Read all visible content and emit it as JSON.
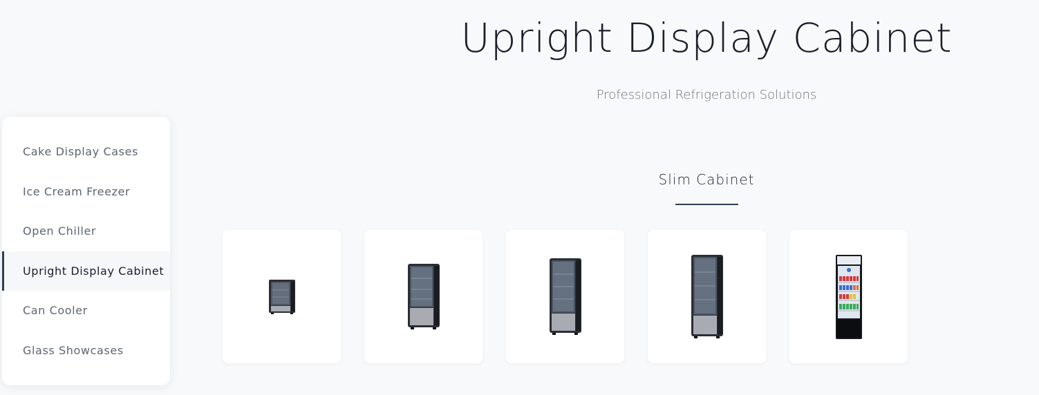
{
  "header": {
    "title": "Upright Display Cabinet",
    "subtitle": "Professional Refrigeration Solutions"
  },
  "sidebar": {
    "items": [
      {
        "label": "Cake Display Cases",
        "active": false
      },
      {
        "label": "Ice Cream Freezer",
        "active": false
      },
      {
        "label": "Open Chiller",
        "active": false
      },
      {
        "label": "Upright Display Cabinet",
        "active": true
      },
      {
        "label": "Can Cooler",
        "active": false
      },
      {
        "label": "Glass Showcases",
        "active": false
      }
    ]
  },
  "section": {
    "title": "Slim Cabinet"
  },
  "products": [
    {
      "icon": "mini-fridge-image"
    },
    {
      "icon": "slim-fridge-image"
    },
    {
      "icon": "tall-slim-fridge-image"
    },
    {
      "icon": "tall-slim-fridge-image"
    },
    {
      "icon": "beverage-cooler-image"
    }
  ],
  "colors": {
    "accent": "#2c3e52",
    "background": "#f8f9fa"
  }
}
